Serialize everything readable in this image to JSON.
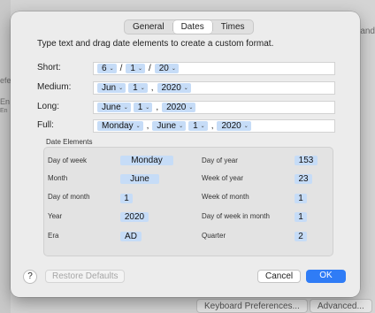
{
  "background": {
    "left_texts": [
      "efe",
      "En",
      "En"
    ],
    "right_text": "and",
    "bottom_buttons": [
      "Keyboard Preferences...",
      "Advanced..."
    ]
  },
  "tabs": [
    "General",
    "Dates",
    "Times"
  ],
  "active_tab": "Dates",
  "instructions": "Type text and drag date elements to create a custom format.",
  "formats": {
    "short": {
      "label": "Short:",
      "t1": "6",
      "s1": "/",
      "t2": "1",
      "s2": "/",
      "t3": "20"
    },
    "medium": {
      "label": "Medium:",
      "t1": "Jun",
      "t2": "1",
      "s2": ",",
      "t3": "2020"
    },
    "long": {
      "label": "Long:",
      "t1": "June",
      "t2": "1",
      "s2": ",",
      "t3": "2020"
    },
    "full": {
      "label": "Full:",
      "t1": "Monday",
      "s1": ",",
      "t2": "June",
      "t3": "1",
      "s3": ",",
      "t4": "2020"
    }
  },
  "date_elements": {
    "title": "Date Elements",
    "left": [
      {
        "label": "Day of week",
        "value": "Monday"
      },
      {
        "label": "Month",
        "value": "June"
      },
      {
        "label": "Day of month",
        "value": "1"
      },
      {
        "label": "Year",
        "value": "2020"
      },
      {
        "label": "Era",
        "value": "AD"
      }
    ],
    "right": [
      {
        "label": "Day of year",
        "value": "153"
      },
      {
        "label": "Week of year",
        "value": "23"
      },
      {
        "label": "Week of month",
        "value": "1"
      },
      {
        "label": "Day of week in month",
        "value": "1"
      },
      {
        "label": "Quarter",
        "value": "2"
      }
    ]
  },
  "buttons": {
    "help": "?",
    "restore": "Restore Defaults",
    "cancel": "Cancel",
    "ok": "OK"
  },
  "colors": {
    "accent": "#2f7cf6",
    "token": "#c6dcf7"
  }
}
